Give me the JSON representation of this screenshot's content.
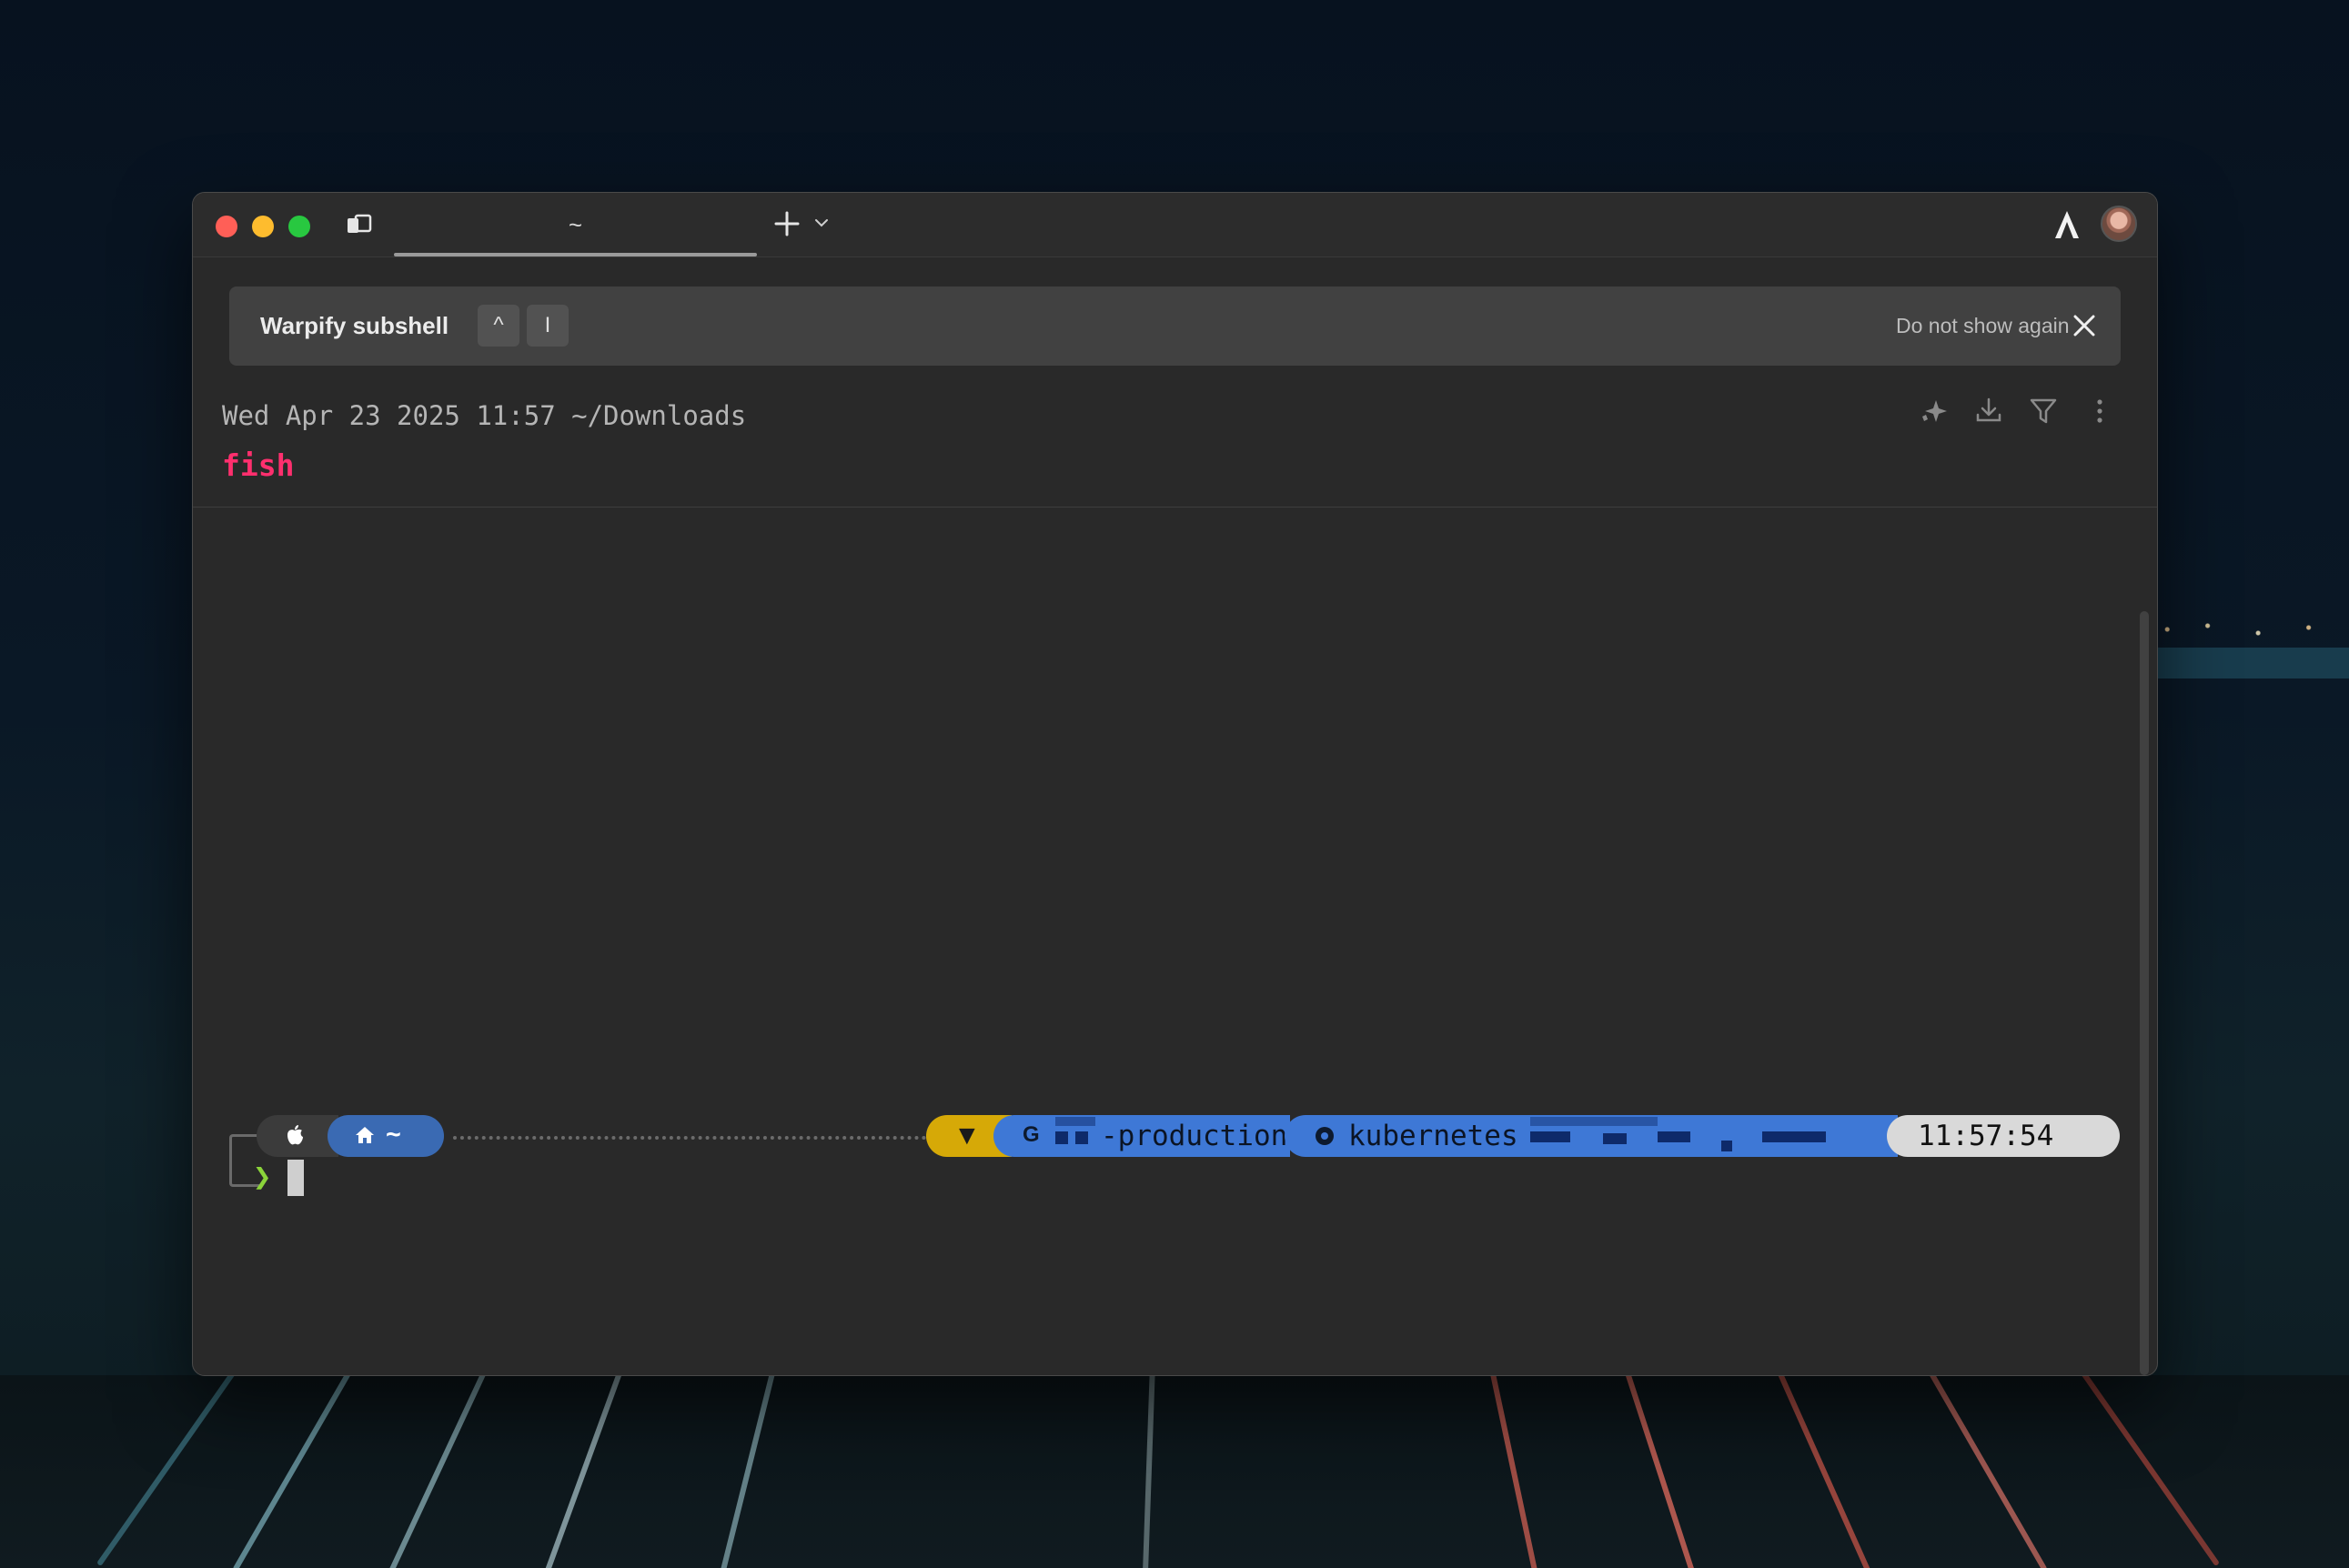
{
  "window": {
    "tab_title": "~"
  },
  "banner": {
    "title": "Warpify subshell",
    "shortcut_keys": [
      "^",
      "I"
    ],
    "dismiss_label": "Do not show again"
  },
  "block": {
    "meta": "Wed Apr 23 2025 11:57 ~/Downloads",
    "command": "fish"
  },
  "prompt": {
    "directory": "~",
    "warning_symbol": "▼",
    "gcp_icon": "G",
    "gcp_project_suffix": "-production",
    "k8s_label": "kubernetes",
    "time": "11:57:54",
    "input_symbol": "❯"
  },
  "colors": {
    "accent_command": "#ff2f6e",
    "dir_segment": "#3a6ab3",
    "cloud_segment": "#3e78d6",
    "warn_segment": "#d6a907",
    "time_segment": "#d9d9d9",
    "prompt_chevron": "#8bd43a"
  },
  "icons": [
    "panels-icon",
    "plus-icon",
    "chevron-down-icon",
    "warp-logo-icon",
    "close-icon",
    "sparkle-icon",
    "download-icon",
    "filter-icon",
    "kebab-menu-icon",
    "apple-icon",
    "home-icon",
    "kubernetes-icon"
  ]
}
